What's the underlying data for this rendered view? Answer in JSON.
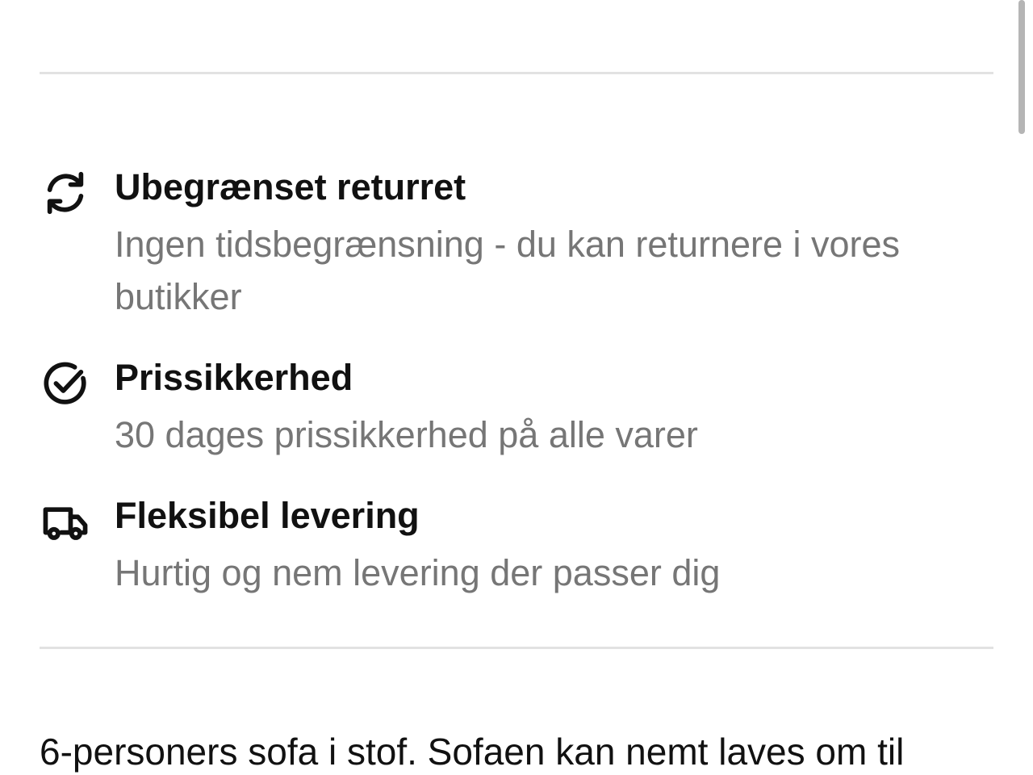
{
  "benefits": [
    {
      "icon": "refresh-icon",
      "title": "Ubegrænset returret",
      "description": "Ingen tidsbegrænsning - du kan returnere i vores butikker"
    },
    {
      "icon": "check-circle-icon",
      "title": "Prissikkerhed",
      "description": "30 dages prissikkerhed på alle varer"
    },
    {
      "icon": "delivery-truck-icon",
      "title": "Fleksibel levering",
      "description": "Hurtig og nem levering der passer dig"
    }
  ],
  "product": {
    "description": "6-personers sofa i stof. Sofaen kan nemt laves om til"
  },
  "colors": {
    "title": "#111111",
    "muted": "#767676",
    "divider": "#e2e2e2"
  }
}
